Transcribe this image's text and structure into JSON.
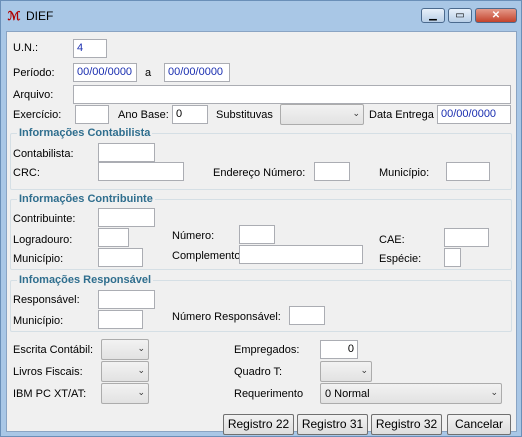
{
  "window": {
    "title": "DIEF",
    "icon": "app-logo-icon"
  },
  "form": {
    "un_label": "U.N.:",
    "un_value": "4",
    "periodo_label": "Período:",
    "periodo_from": "00/00/0000",
    "periodo_sep": "a",
    "periodo_to": "00/00/0000",
    "arquivo_label": "Arquivo:",
    "arquivo_value": "",
    "exercicio_label": "Exercício:",
    "exercicio_value": "",
    "ano_base_label": "Ano Base:",
    "ano_base_value": "0",
    "substitutivas_label": "Substituvas",
    "substitutivas_value": "",
    "data_entrega_label": "Data Entrega",
    "data_entrega_value": "00/00/0000"
  },
  "contabilista": {
    "title": "Informações Contabilista",
    "contabilista_label": "Contabilista:",
    "crc_label": "CRC:",
    "endereco_numero_label": "Endereço Número:",
    "municipio_label": "Município:"
  },
  "contribuinte": {
    "title": "Informações Contribuinte",
    "contribuinte_label": "Contribuinte:",
    "logradouro_label": "Logradouro:",
    "municipio_label": "Município:",
    "numero_label": "Número:",
    "complemento_label": "Complemento:",
    "cae_label": "CAE:",
    "especie_label": "Espécie:"
  },
  "responsavel": {
    "title": "Infomações Responsável",
    "responsavel_label": "Responsável:",
    "municipio_label": "Município:",
    "numero_responsavel_label": "Número Responsável:"
  },
  "extras": {
    "escrita_contabil_label": "Escrita Contábil:",
    "livros_fiscais_label": "Livros Fiscais:",
    "ibm_label": "IBM PC XT/AT:",
    "empregados_label": "Empregados:",
    "empregados_value": "0",
    "quadro_t_label": "Quadro T:",
    "requerimento_label": "Requerimento",
    "requerimento_value": "0 Normal"
  },
  "buttons": {
    "registro22": "Registro 22",
    "registro31": "Registro 31",
    "registro32": "Registro 32",
    "cancelar": "Cancelar"
  }
}
